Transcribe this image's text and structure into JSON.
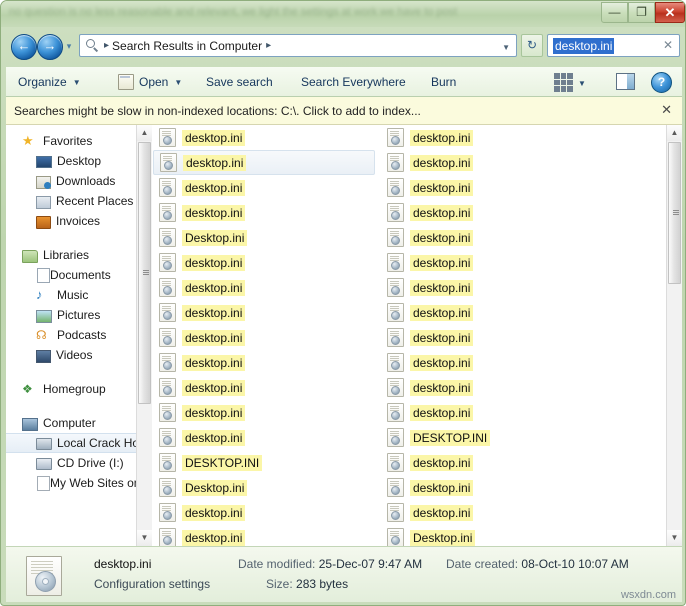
{
  "window": {
    "title_ghost": "no question is no less reasonable and relevant, we light the settings at work we have to post",
    "controls": {
      "minimize": "—",
      "maximize": "❐",
      "close": "✕"
    }
  },
  "addressbar": {
    "back_glyph": "←",
    "forward_glyph": "→",
    "recent_glyph": "▾",
    "icon": "search-icon",
    "crumb_prefix": "▸",
    "crumb_text": "Search Results in Computer",
    "crumb_suffix": "▸",
    "dropdown_glyph": "▼",
    "refresh_glyph": "↻"
  },
  "search": {
    "value": "desktop.ini",
    "clear_glyph": "✕"
  },
  "toolbar": {
    "organize_label": "Organize",
    "organize_caret": "▼",
    "open_label": "Open",
    "open_caret": "▼",
    "save_search_label": "Save search",
    "search_everywhere_label": "Search Everywhere",
    "burn_label": "Burn",
    "views_caret": "▼",
    "help_glyph": "?"
  },
  "infobar": {
    "message": "Searches might be slow in non-indexed locations: C:\\. Click to add to index...",
    "close_glyph": "✕"
  },
  "sidebar": {
    "groups": [
      {
        "head": {
          "label": "Favorites",
          "icon": "star-icon"
        },
        "items": [
          {
            "label": "Desktop",
            "icon": "desktop-icon"
          },
          {
            "label": "Downloads",
            "icon": "downloads-icon"
          },
          {
            "label": "Recent Places",
            "icon": "recent-places-icon"
          },
          {
            "label": "Invoices",
            "icon": "invoices-folder-icon"
          }
        ]
      },
      {
        "head": {
          "label": "Libraries",
          "icon": "libraries-icon"
        },
        "items": [
          {
            "label": "Documents",
            "icon": "documents-icon"
          },
          {
            "label": "Music",
            "icon": "music-icon"
          },
          {
            "label": "Pictures",
            "icon": "pictures-icon"
          },
          {
            "label": "Podcasts",
            "icon": "podcasts-icon"
          },
          {
            "label": "Videos",
            "icon": "videos-icon"
          }
        ]
      },
      {
        "head": {
          "label": "Homegroup",
          "icon": "homegroup-icon"
        },
        "items": []
      },
      {
        "head": {
          "label": "Computer",
          "icon": "computer-icon"
        },
        "items": [
          {
            "label": "Local Crack Hou",
            "icon": "drive-icon",
            "selected": true
          },
          {
            "label": "CD Drive (I:)",
            "icon": "cd-drive-icon"
          },
          {
            "label": "My Web Sites on",
            "icon": "web-sites-icon"
          }
        ]
      }
    ]
  },
  "filelist": {
    "columns": [
      {
        "files": [
          "desktop.ini",
          "desktop.ini",
          "desktop.ini",
          "desktop.ini",
          "Desktop.ini",
          "desktop.ini",
          "desktop.ini",
          "desktop.ini",
          "desktop.ini",
          "desktop.ini",
          "desktop.ini",
          "desktop.ini",
          "desktop.ini",
          "DESKTOP.INI",
          "Desktop.ini",
          "desktop.ini",
          "desktop.ini"
        ],
        "selected_index": 1
      },
      {
        "files": [
          "desktop.ini",
          "desktop.ini",
          "desktop.ini",
          "desktop.ini",
          "desktop.ini",
          "desktop.ini",
          "desktop.ini",
          "desktop.ini",
          "desktop.ini",
          "desktop.ini",
          "desktop.ini",
          "desktop.ini",
          "DESKTOP.INI",
          "desktop.ini",
          "desktop.ini",
          "desktop.ini",
          "Desktop.ini"
        ],
        "selected_index": -1
      }
    ]
  },
  "details": {
    "name": "desktop.ini",
    "type": "Configuration settings",
    "date_modified_label": "Date modified:",
    "date_modified_value": "25-Dec-07 9:47 AM",
    "size_label": "Size:",
    "size_value": "283 bytes",
    "date_created_label": "Date created:",
    "date_created_value": "08-Oct-10 10:07 AM"
  },
  "watermark": "wsxdn.com",
  "colors": {
    "highlight_yellow": "#fbf6a8",
    "selection_blue": "#2f6fce",
    "infobar_bg": "#fbfbdd",
    "close_red": "#cc4430"
  }
}
